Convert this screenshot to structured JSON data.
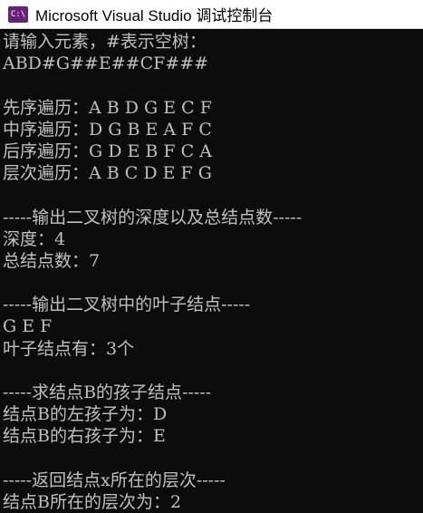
{
  "window": {
    "title": "Microsoft Visual Studio 调试控制台",
    "icon_text": "C:\\"
  },
  "console": {
    "lines": [
      "请输入元素，#表示空树：",
      "ABD#G##E##CF###",
      "",
      "先序遍历：A B D G E C F",
      "中序遍历：D G B E A F C",
      "后序遍历：G D E B F C A",
      "层次遍历：A B C D E F G",
      "",
      "-----输出二叉树的深度以及总结点数-----",
      "深度：4",
      "总结点数：7",
      "",
      "-----输出二叉树中的叶子结点-----",
      "G E F",
      "叶子结点有：3个",
      "",
      "-----求结点B的孩子结点-----",
      "结点B的左孩子为：D",
      "结点B的右孩子为：E",
      "",
      "-----返回结点x所在的层次-----",
      "结点B所在的层次为：2"
    ]
  }
}
